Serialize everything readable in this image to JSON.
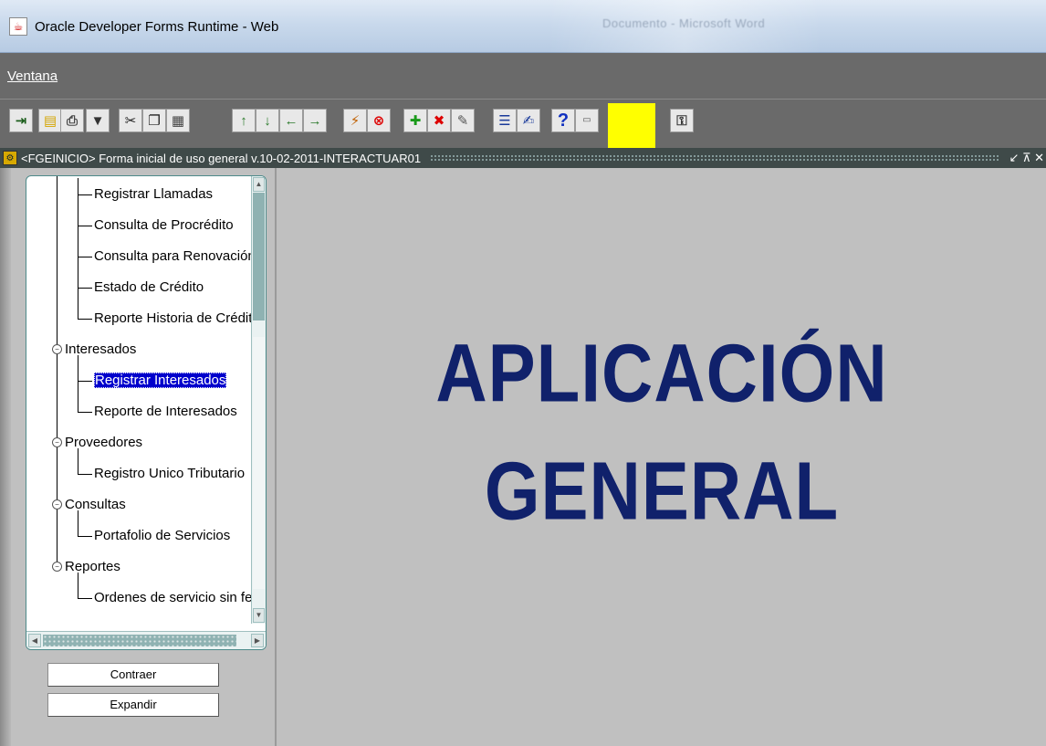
{
  "window": {
    "title": "Oracle Developer Forms Runtime - Web",
    "background_taskbar_text": "Documento - Microsoft Word"
  },
  "menu": {
    "items": [
      {
        "label": "Ventana"
      }
    ]
  },
  "toolbar": {
    "buttons": [
      {
        "name": "exit-icon",
        "glyph": "⇥"
      },
      {
        "name": "save-icon",
        "glyph": "▤"
      },
      {
        "name": "print-icon",
        "glyph": "⎙"
      },
      {
        "name": "clear-icon",
        "glyph": "▼"
      },
      {
        "name": "cut-icon",
        "glyph": "✂"
      },
      {
        "name": "copy-icon",
        "glyph": "❐"
      },
      {
        "name": "paste-icon",
        "glyph": "▦"
      },
      {
        "name": "up-icon",
        "glyph": "↑"
      },
      {
        "name": "down-icon",
        "glyph": "↓"
      },
      {
        "name": "left-icon",
        "glyph": "←"
      },
      {
        "name": "right-icon",
        "glyph": "→"
      },
      {
        "name": "execute-query-icon",
        "glyph": "⚡"
      },
      {
        "name": "cancel-query-icon",
        "glyph": "⊗"
      },
      {
        "name": "insert-record-icon",
        "glyph": "✚"
      },
      {
        "name": "delete-record-icon",
        "glyph": "✖"
      },
      {
        "name": "lock-record-icon",
        "glyph": "✎"
      },
      {
        "name": "list-values-icon",
        "glyph": "☰"
      },
      {
        "name": "edit-icon",
        "glyph": "✍"
      },
      {
        "name": "help-icon",
        "glyph": "?"
      },
      {
        "name": "mdx-icon",
        "glyph": "▭"
      },
      {
        "name": "keys-icon",
        "glyph": "⚿"
      }
    ],
    "highlight_color": "#ffff00"
  },
  "form": {
    "title": "<FGEINICIO> Forma inicial de uso general v.10-02-2011-INTERACTUAR01",
    "controls": "↙ ⊼ ✕"
  },
  "tree": {
    "items": [
      {
        "label": "Registrar Llamadas",
        "level": 2
      },
      {
        "label": "Consulta de Procrédito",
        "level": 2
      },
      {
        "label": "Consulta para Renovación",
        "level": 2
      },
      {
        "label": "Estado de Crédito",
        "level": 2
      },
      {
        "label": "Reporte Historia de Crédito",
        "level": 2
      },
      {
        "label": "Interesados",
        "level": 1
      },
      {
        "label": "Registrar Interesados",
        "level": 2,
        "selected": true
      },
      {
        "label": "Reporte de Interesados",
        "level": 2
      },
      {
        "label": "Proveedores",
        "level": 1
      },
      {
        "label": "Registro Unico Tributario",
        "level": 2
      },
      {
        "label": "Consultas",
        "level": 1
      },
      {
        "label": "Portafolio de Servicios",
        "level": 2
      },
      {
        "label": "Reportes",
        "level": 1
      },
      {
        "label": "Ordenes de servicio sin fec",
        "level": 2
      }
    ]
  },
  "buttons": {
    "collapse": "Contraer",
    "expand": "Expandir"
  },
  "main": {
    "line1": "APLICACIÓN",
    "line2": "GENERAL"
  },
  "colors": {
    "title_text": "#10216b",
    "selection": "#0000cc",
    "menu_bg": "#6a6a6a",
    "canvas_bg": "#c0c0c0"
  }
}
